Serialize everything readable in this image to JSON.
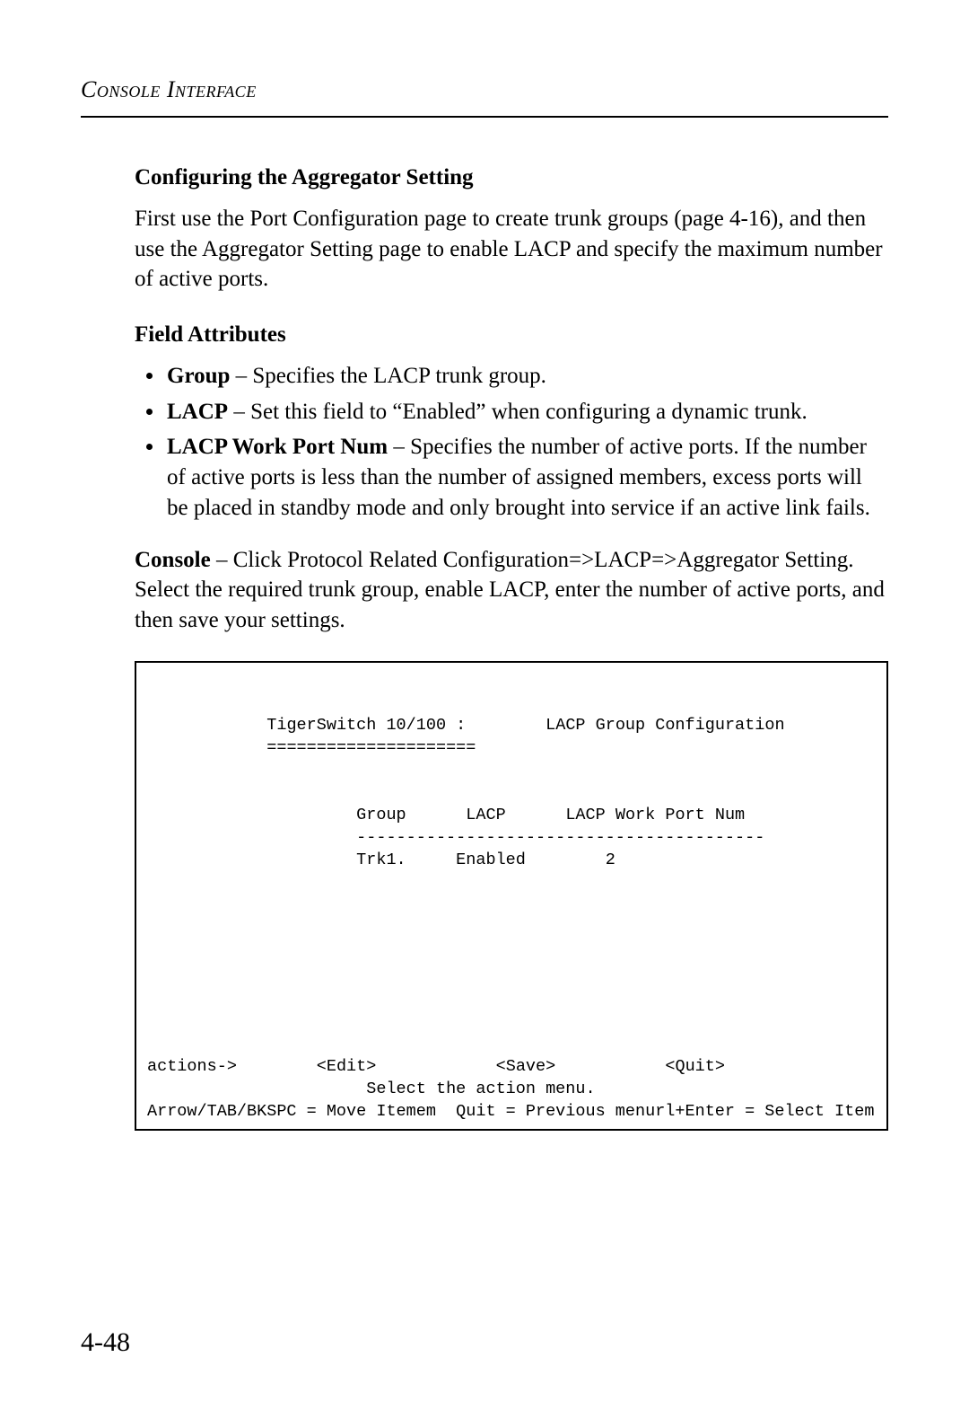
{
  "runningHead": "Console Interface",
  "section": {
    "title": "Configuring the Aggregator Setting",
    "intro": "First use the Port Configuration page to create trunk groups (page 4-16), and then use the Aggregator Setting page to enable LACP and specify the maximum number of active ports.",
    "fieldHeading": "Field Attributes",
    "fields": [
      {
        "term": "Group",
        "desc": " – Specifies the LACP trunk group."
      },
      {
        "term": "LACP",
        "desc": " – Set this field to “Enabled” when configuring a dynamic trunk."
      },
      {
        "term": "LACP Work Port Num",
        "desc": " – Specifies the number of active ports. If the number of active ports is less than the number of assigned members, excess ports will be placed in standby mode and only brought into service if an active link fails."
      }
    ],
    "consoleLead": {
      "term": "Console",
      "desc": " – Click Protocol Related Configuration=>LACP=>Aggregator Setting. Select the required trunk group, enable LACP, enter the number of active ports, and then save your settings."
    }
  },
  "console": {
    "deviceLabel": "TigerSwitch 10/100 :",
    "underline": "=====================",
    "screenTitle": "LACP Group Configuration",
    "columns": {
      "c1": "Group",
      "c2": "LACP",
      "c3": "LACP Work Port Num"
    },
    "colRule": "-----------------------------------------",
    "row": {
      "group": "Trk1.",
      "lacp": "Enabled",
      "workPort": "2"
    },
    "actionsLabel": "actions->",
    "actions": {
      "edit": "<Edit>",
      "save": "<Save>",
      "quit": "<Quit>"
    },
    "hint1": "Select the action menu.",
    "hint2": "Arrow/TAB/BKSPC = Move Itemem  Quit = Previous menurl+Enter = Select Item"
  },
  "pageNumber": "4-48"
}
